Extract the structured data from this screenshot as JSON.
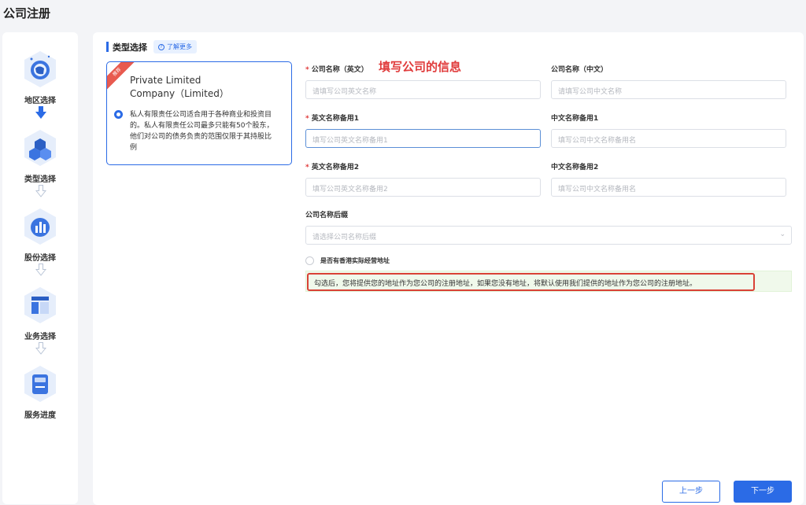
{
  "page": {
    "title": "公司注册"
  },
  "steps": [
    {
      "label": "地区选择",
      "icon": "globe-icon"
    },
    {
      "label": "类型选择",
      "icon": "cubes-icon"
    },
    {
      "label": "股份选择",
      "icon": "bar-chart-icon"
    },
    {
      "label": "业务选择",
      "icon": "layout-icon"
    },
    {
      "label": "服务进度",
      "icon": "document-icon"
    }
  ],
  "section": {
    "title": "类型选择",
    "learn_more": "了解更多"
  },
  "type_card": {
    "ribbon": "推荐",
    "title": "Private Limited Company（Limited）",
    "description": "私人有限责任公司适合用于各种商业和投资目的。私人有限责任公司最多只能有50个股东，他们对公司的债务负责的范围仅限于其持股比例"
  },
  "annotation": "填写公司的信息",
  "form": {
    "name_en": {
      "label": "公司名称（英文）",
      "placeholder": "请填写公司英文名称",
      "required": true
    },
    "name_cn": {
      "label": "公司名称（中文）",
      "placeholder": "请填写公司中文名称"
    },
    "alt_en_1": {
      "label": "英文名称备用1",
      "placeholder": "填写公司英文名称备用1",
      "required": true
    },
    "alt_cn_1": {
      "label": "中文名称备用1",
      "placeholder": "填写公司中文名称备用名"
    },
    "alt_en_2": {
      "label": "英文名称备用2",
      "placeholder": "填写公司英文名称备用2",
      "required": true
    },
    "alt_cn_2": {
      "label": "中文名称备用2",
      "placeholder": "填写公司中文名称备用名"
    },
    "suffix": {
      "label": "公司名称后缀",
      "placeholder": "请选择公司名称后缀"
    },
    "hk_address": {
      "label": "是否有香港实际经营地址"
    },
    "notice": "勾选后，您将提供您的地址作为您公司的注册地址，如果您没有地址，将默认使用我们提供的地址作为您公司的注册地址。"
  },
  "buttons": {
    "prev": "上一步",
    "next": "下一步"
  },
  "colors": {
    "accent": "#2b6be6",
    "required": "#e03b3b",
    "highlight": "#d94236"
  }
}
